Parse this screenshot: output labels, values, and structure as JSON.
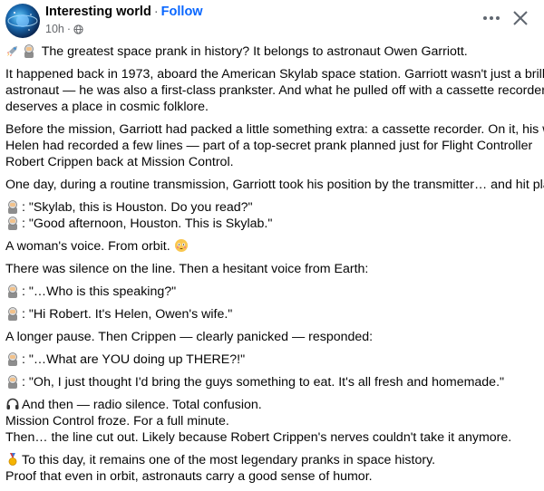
{
  "header": {
    "page_name": "Interesting world",
    "separator": "·",
    "follow_label": "Follow",
    "time": "10h",
    "time_sep": "·",
    "privacy_icon": "globe-icon",
    "more_icon": "more-options-icon",
    "close_icon": "close-icon"
  },
  "post": {
    "headline": "The greatest space prank in history? It belongs to astronaut Owen Garriott.",
    "intro": [
      "It happened back in 1973, aboard the American Skylab space station. Garriott wasn't just a brilliant",
      "astronaut — he was also a first-class prankster. And what he pulled off with a cassette recorder",
      "deserves a place in cosmic folklore."
    ],
    "setup": [
      "Before the mission, Garriott had packed a little something extra: a cassette recorder. On it, his wife",
      "Helen had recorded a few lines — part of a top-secret prank planned just for Flight Controller",
      "Robert Crippen back at Mission Control."
    ],
    "transmission": "One day, during a routine transmission, Garriott took his position by the transmitter… and hit play.",
    "dialogue1a": ": \"Skylab, this is Houston. Do you read?\"",
    "dialogue1b": ": \"Good afternoon, Houston. This is Skylab.\"",
    "womans_voice": "A woman's voice. From orbit.",
    "silence": "There was silence on the line. Then a hesitant voice from Earth:",
    "dialogue2": ": \"…Who is this speaking?\"",
    "dialogue3": ": \"Hi Robert. It's Helen, Owen's wife.\"",
    "pause": "A longer pause. Then Crippen — clearly panicked — responded:",
    "dialogue4": ": \"…What are YOU doing up THERE?!\"",
    "dialogue5": ": \"Oh, I just thought I'd bring the guys something to eat. It's all fresh and homemade.\"",
    "aftermath": [
      "And then — radio silence. Total confusion.",
      "Mission Control froze. For a full minute.",
      "Then… the line cut out. Likely because Robert Crippen's nerves couldn't take it anymore."
    ],
    "ending": [
      "To this day, it remains one of the most legendary pranks in space history.",
      "Proof that even in orbit, astronauts carry a good sense of humor."
    ],
    "emoji": {
      "rocket": "rocket-emoji",
      "astronaut": "astronaut-emoji",
      "flushed": "flushed-face-emoji",
      "headphones": "headphones-emoji",
      "medal": "medal-emoji"
    }
  }
}
